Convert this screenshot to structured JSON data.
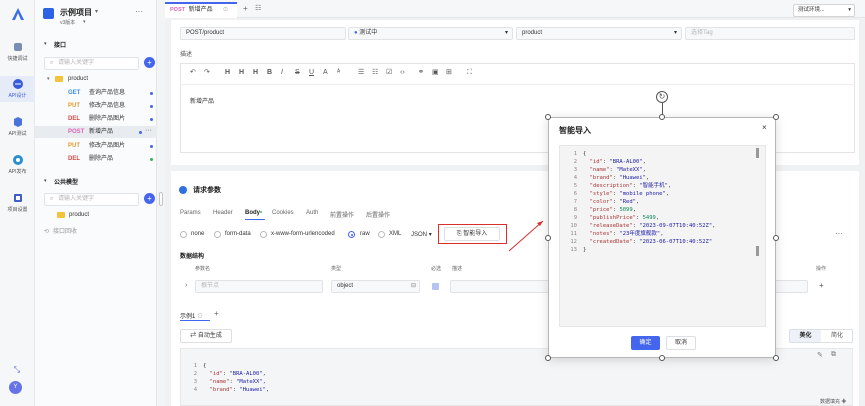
{
  "rail": {
    "items": [
      {
        "label": "快捷调试"
      },
      {
        "label": "API设计"
      },
      {
        "label": "API测试"
      },
      {
        "label": "API发布"
      },
      {
        "label": "项目设置"
      }
    ],
    "avatar": "Y"
  },
  "project": {
    "name": "示例项目",
    "version": "v3版本",
    "section_interface": "接口",
    "search_placeholder": "请输入关键字",
    "folder": "product",
    "apis": [
      {
        "method": "GET",
        "name": "查询产品信息"
      },
      {
        "method": "PUT",
        "name": "修改产品信息"
      },
      {
        "method": "DEL",
        "name": "删除产品图片"
      },
      {
        "method": "POST",
        "name": "新增产品"
      },
      {
        "method": "PUT",
        "name": "修改产品图片"
      },
      {
        "method": "DEL",
        "name": "删除产品"
      }
    ],
    "section_models": "公共模型",
    "model_search_placeholder": "请输入关键字",
    "model_folder": "product",
    "recycle": "接口回收"
  },
  "tabs": {
    "active_method": "POST",
    "active_title": "新增产品",
    "env": "测试环境..."
  },
  "api_form": {
    "path": "POST/product",
    "status": "测试中",
    "category": "product",
    "tag_placeholder": "选择Tag",
    "desc_label": "描述",
    "editor_content": "新增产品"
  },
  "toolbar_icons": [
    "undo-icon",
    "redo-icon",
    "h1-icon",
    "h2-icon",
    "h3-icon",
    "bold-icon",
    "italic-icon",
    "strike-icon",
    "underline-icon",
    "subscript-icon",
    "superscript-icon",
    "bullet-list-icon",
    "ordered-list-icon",
    "task-list-icon",
    "code-icon",
    "link-icon",
    "image-icon",
    "table-icon",
    "fullscreen-icon"
  ],
  "request": {
    "title": "请求参数",
    "tabs": [
      "Params",
      "Header",
      "Body",
      "Cookies",
      "Auth",
      "前置操作",
      "后置操作"
    ],
    "body_types": [
      "none",
      "form-data",
      "x-www-form-urlencoded",
      "raw",
      "XML"
    ],
    "format": "JSON",
    "smart_import": "智能导入",
    "structure_label": "数据结构",
    "columns": [
      "参数名",
      "类型",
      "必选",
      "描述",
      "操作"
    ],
    "param_placeholder": "根节点",
    "param_type": "object",
    "example_tab": "示例1",
    "auto_generate": "自动生成",
    "beautify": "美化",
    "minify": "简化",
    "code_lines": [
      {
        "n": "1",
        "text": "{"
      },
      {
        "n": "2",
        "key": "\"id\"",
        "val": "\"BRA-AL00\","
      },
      {
        "n": "3",
        "key": "\"name\"",
        "val": "\"MateXX\","
      },
      {
        "n": "4",
        "key": "\"brand\"",
        "val": "\"Huawei\","
      }
    ],
    "footer_note": "数据填充"
  },
  "modal": {
    "title": "智能导入",
    "lines": [
      {
        "n": "1",
        "text": "{"
      },
      {
        "n": "2",
        "key": "\"id\"",
        "val": "\"BRA-AL00\"",
        "type": "s"
      },
      {
        "n": "3",
        "key": "\"name\"",
        "val": "\"MateXX\"",
        "type": "s"
      },
      {
        "n": "4",
        "key": "\"brand\"",
        "val": "\"Huawei\"",
        "type": "s"
      },
      {
        "n": "5",
        "key": "\"description\"",
        "val": "\"智能手机\"",
        "type": "s"
      },
      {
        "n": "6",
        "key": "\"style\"",
        "val": "\"mobile phone\"",
        "type": "s"
      },
      {
        "n": "7",
        "key": "\"color\"",
        "val": "\"Red\"",
        "type": "s"
      },
      {
        "n": "8",
        "key": "\"price\"",
        "val": "5099",
        "type": "n"
      },
      {
        "n": "9",
        "key": "\"publishPrice\"",
        "val": "5499",
        "type": "n"
      },
      {
        "n": "10",
        "key": "\"releaseDate\"",
        "val": "\"2023-09-07T10:40:52Z\"",
        "type": "s"
      },
      {
        "n": "11",
        "key": "\"notes\"",
        "val": "\"23年度旗舰款\"",
        "type": "s"
      },
      {
        "n": "12",
        "key": "\"createdDate\"",
        "val": "\"2023-06-07T10:40:52Z\"",
        "type": "s"
      },
      {
        "n": "13",
        "text": "}"
      }
    ],
    "confirm": "确定",
    "cancel": "取消"
  },
  "colors": {
    "accent": "#4466ee",
    "highlight_border": "#d9302e",
    "sidebar_bg": "#fafbfc",
    "main_bg": "#f0f1f3"
  }
}
